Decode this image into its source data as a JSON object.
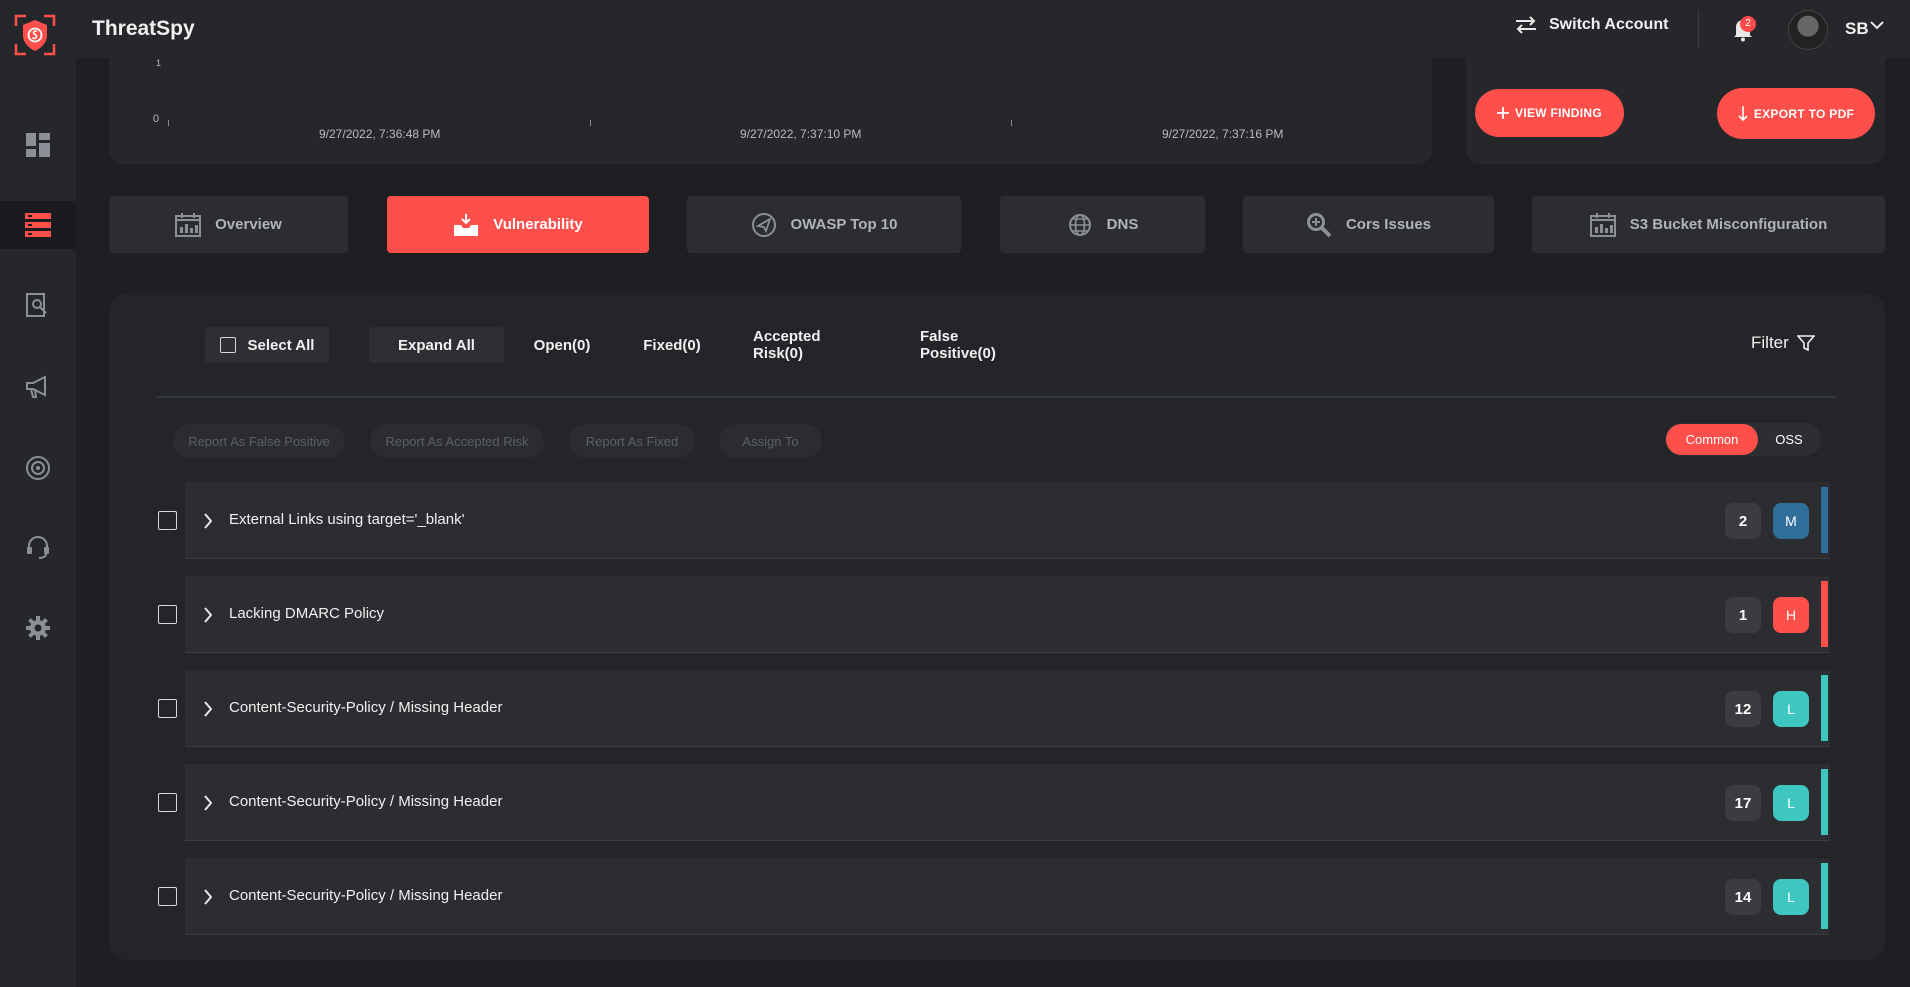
{
  "app": {
    "title": "ThreatSpy"
  },
  "header": {
    "switch_account": "Switch Account",
    "notifications_count": "2",
    "user_initials": "SB"
  },
  "chart": {
    "y_top": "1",
    "y_bottom": "0",
    "x_labels": [
      "9/27/2022, 7:36:48 PM",
      "9/27/2022, 7:37:10 PM",
      "9/27/2022, 7:37:16 PM"
    ]
  },
  "actions": {
    "view_finding": "VIEW FINDING",
    "export_pdf": "EXPORT TO PDF"
  },
  "tabs": [
    {
      "label": "Overview",
      "icon": "report-chart-icon"
    },
    {
      "label": "Vulnerability",
      "icon": "inbox-tray-icon"
    },
    {
      "label": "OWASP Top 10",
      "icon": "paper-plane-icon"
    },
    {
      "label": "DNS",
      "icon": "globe-icon"
    },
    {
      "label": "Cors Issues",
      "icon": "magnifier-icon"
    },
    {
      "label": "S3 Bucket Misconfiguration",
      "icon": "report-chart-icon"
    }
  ],
  "toolbar": {
    "select_all": "Select All",
    "expand_all": "Expand All",
    "open": "Open(0)",
    "fixed": "Fixed(0)",
    "accepted_risk": "Accepted Risk(0)",
    "false_positive": "False Positive(0)",
    "filter": "Filter"
  },
  "report_actions": [
    "Report As False Positive",
    "Report As Accepted Risk",
    "Report As Fixed",
    "Assign To"
  ],
  "view_toggle": {
    "common": "Common",
    "oss": "OSS"
  },
  "colors": {
    "accent": "#ff4f4b",
    "medium": "#2f6f9a",
    "high": "#ff4f4b",
    "low": "#3ec7c1"
  },
  "findings": [
    {
      "title": "External Links using target='_blank'",
      "count": "2",
      "severity": "M",
      "color": "#2f6f9a"
    },
    {
      "title": "Lacking DMARC Policy",
      "count": "1",
      "severity": "H",
      "color": "#ff4f4b"
    },
    {
      "title": "Content-Security-Policy / Missing Header",
      "count": "12",
      "severity": "L",
      "color": "#3ec7c1"
    },
    {
      "title": "Content-Security-Policy / Missing Header",
      "count": "17",
      "severity": "L",
      "color": "#3ec7c1"
    },
    {
      "title": "Content-Security-Policy / Missing Header",
      "count": "14",
      "severity": "L",
      "color": "#3ec7c1"
    }
  ]
}
